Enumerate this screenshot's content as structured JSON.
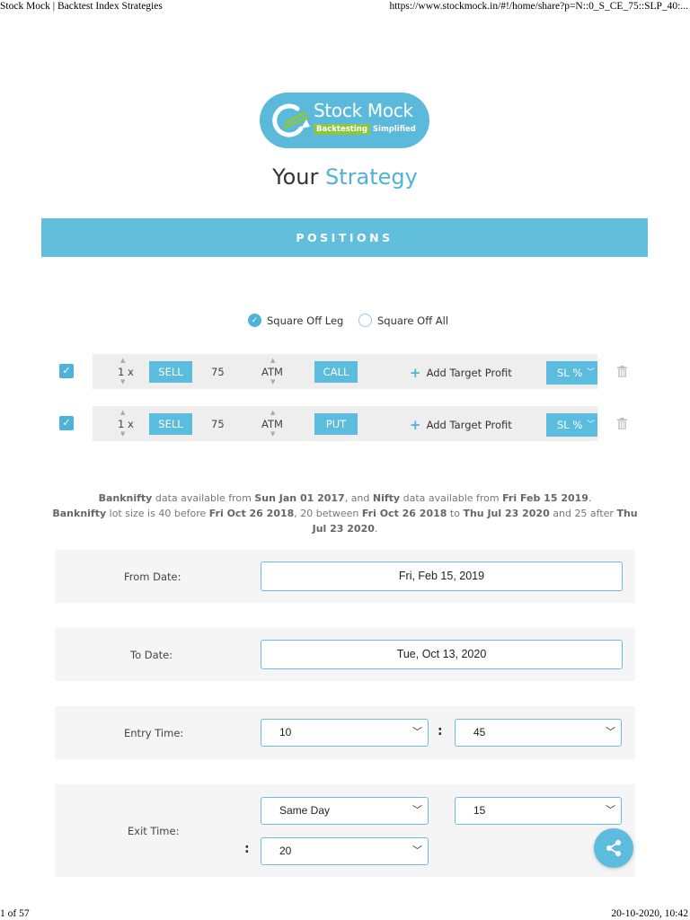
{
  "print_header": {
    "title": "Stock Mock | Backtest Index Strategies",
    "url": "https://www.stockmock.in/#!/home/share?p=N::0_S_CE_75::SLP_40:..."
  },
  "print_footer": {
    "page": "1 of 57",
    "datetime": "20-10-2020, 10:42"
  },
  "logo": {
    "title": "Stock Mock",
    "tagline_highlight": "Backtesting",
    "tagline_rest": "Simplified"
  },
  "heading": {
    "prefix": "Your",
    "accent": "Strategy"
  },
  "positions_label": "POSITIONS",
  "square_off": {
    "leg_label": "Square Off Leg",
    "all_label": "Square Off All",
    "selected": "leg"
  },
  "legs": [
    {
      "qty": "1 x",
      "action": "SELL",
      "lots": "75",
      "strike": "ATM",
      "option": "CALL",
      "target_label": "Add Target Profit",
      "sl_label": "SL %"
    },
    {
      "qty": "1 x",
      "action": "SELL",
      "lots": "75",
      "strike": "ATM",
      "option": "PUT",
      "target_label": "Add Target Profit",
      "sl_label": "SL %"
    }
  ],
  "info": {
    "l1_a": "Banknifty",
    "l1_b": " data available from ",
    "l1_c": "Sun Jan 01 2017",
    "l1_d": ", and ",
    "l1_e": "Nifty",
    "l1_f": " data available from ",
    "l1_g": "Fri Feb 15 2019",
    "l1_h": ".",
    "l2_a": "Banknifty",
    "l2_b": " lot size is 40 before ",
    "l2_c": "Fri Oct 26 2018",
    "l2_d": ", 20 between ",
    "l2_e": "Fri Oct 26 2018",
    "l2_f": " to ",
    "l2_g": "Thu Jul 23 2020",
    "l2_h": " and 25 after ",
    "l2_i": "Thu Jul 23 2020",
    "l2_j": "."
  },
  "form": {
    "from_label": "From Date:",
    "from_value": "Fri, Feb 15, 2019",
    "to_label": "To Date:",
    "to_value": "Tue, Oct 13, 2020",
    "entry_label": "Entry Time:",
    "entry_hour": "10",
    "entry_minute": "45",
    "exit_label": "Exit Time:",
    "exit_day": "Same Day",
    "exit_hour": "15",
    "exit_minute": "20"
  },
  "colors": {
    "accent": "#5bbcdd",
    "bar": "#62bfdb",
    "logo_green": "#8dc63f"
  },
  "icons": [
    "check-icon",
    "arrow-up-icon",
    "arrow-down-icon",
    "plus-icon",
    "chevron-down-icon",
    "trash-icon",
    "share-icon"
  ]
}
